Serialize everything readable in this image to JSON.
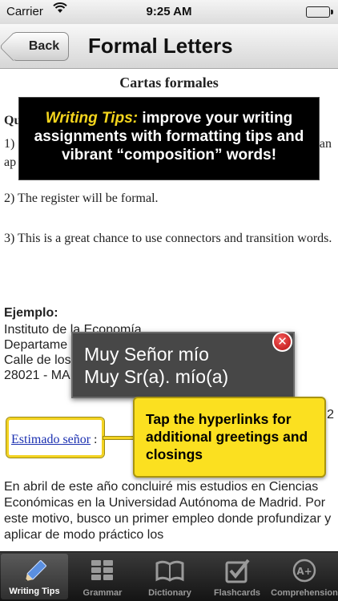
{
  "status_bar": {
    "carrier": "Carrier",
    "time": "9:25 AM",
    "battery_level": 1.0
  },
  "nav": {
    "back_label": "Back",
    "title": "Formal Letters"
  },
  "document": {
    "title": "Cartas formales",
    "heading_fragment": "Qu",
    "p1_start": "1)",
    "p1_end": "an",
    "p1_line2": "ap",
    "p2": "2) The register will be formal.",
    "p3": "3) This is a great chance to use connectors and transition words.",
    "example_label": "Ejemplo:",
    "address": [
      "Instituto de la Economía",
      "Departame",
      "Calle de los",
      "28021 - MA"
    ],
    "date_fragment": "2",
    "greeting_link": "Estimado señor",
    "greeting_colon": ":",
    "body": "En abril de este año concluiré mis estudios en Ciencias Económicas en la Universidad Autónoma de Madrid. Por este motivo, busco un primer empleo donde profundizar y aplicar de modo práctico los"
  },
  "tip_overlay": {
    "heading": "Writing Tips:",
    "text": " improve your writing assignments with formatting tips and vibrant “composition” words!"
  },
  "popup": {
    "line1": "Muy Señor mío",
    "line2": "Muy Sr(a). mío(a)"
  },
  "callout": {
    "text": "Tap the hyperlinks for additional greetings and closings"
  },
  "tabs": [
    {
      "label": "Writing Tips",
      "icon": "pencil-icon",
      "active": true
    },
    {
      "label": "Grammar",
      "icon": "grid-icon",
      "active": false
    },
    {
      "label": "Dictionary",
      "icon": "book-icon",
      "active": false
    },
    {
      "label": "Flashcards",
      "icon": "checkbox-icon",
      "active": false
    },
    {
      "label": "Comprehension",
      "icon": "grade-icon",
      "active": false
    }
  ],
  "colors": {
    "tip_heading": "#f4d51d",
    "callout_bg": "#fbe020",
    "link": "#1a2fb0",
    "close_red": "#d32020"
  }
}
